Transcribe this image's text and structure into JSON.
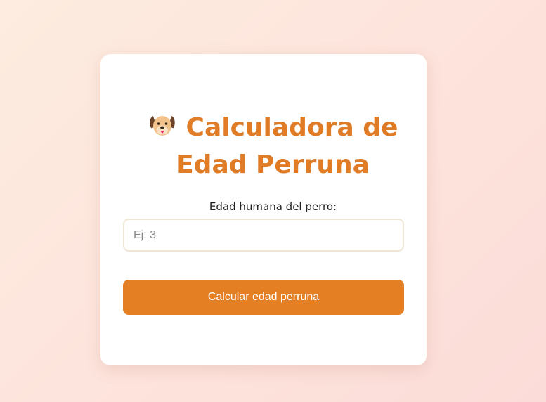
{
  "calculator": {
    "title_line1": "Calculadora de",
    "title_line2": "Edad Perruna",
    "title_icon": "dog-face-icon",
    "input_label": "Edad humana del perro:",
    "input_value": "",
    "input_placeholder": "Ej: 3",
    "button_label": "Calcular edad perruna"
  },
  "colors": {
    "accent": "#e07b26",
    "button": "#e57f23",
    "card_background": "#ffffff",
    "input_border": "#efe6d6"
  }
}
